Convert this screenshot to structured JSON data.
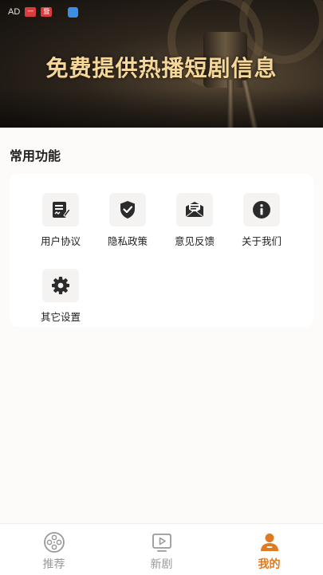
{
  "status_bar": {
    "left_text": "AD",
    "badge1": "一",
    "badge2": "暨"
  },
  "banner": {
    "title": "免费提供热播短剧信息"
  },
  "section": {
    "title": "常用功能"
  },
  "functions": [
    {
      "label": "用户协议",
      "icon": "document-icon"
    },
    {
      "label": "隐私政策",
      "icon": "shield-check-icon"
    },
    {
      "label": "意见反馈",
      "icon": "mail-icon"
    },
    {
      "label": "关于我们",
      "icon": "info-icon"
    },
    {
      "label": "其它设置",
      "icon": "gear-icon"
    }
  ],
  "tabbar": {
    "tabs": [
      {
        "label": "推荐",
        "icon": "film-reel-icon",
        "active": false
      },
      {
        "label": "新剧",
        "icon": "play-box-icon",
        "active": false
      },
      {
        "label": "我的",
        "icon": "user-icon",
        "active": true
      }
    ]
  },
  "colors": {
    "accent": "#e07a22",
    "banner_text": "#f5d79a",
    "icon": "#2b2b2b",
    "inactive": "#999999"
  }
}
